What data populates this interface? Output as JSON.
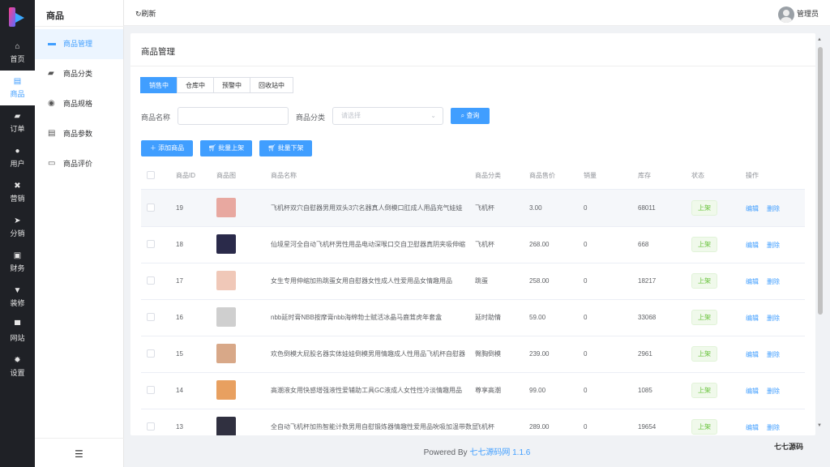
{
  "rail": {
    "items": [
      {
        "label": "首页",
        "icon": "home-icon"
      },
      {
        "label": "商品",
        "icon": "goods-icon"
      },
      {
        "label": "订单",
        "icon": "order-icon"
      },
      {
        "label": "用户",
        "icon": "user-icon"
      },
      {
        "label": "营销",
        "icon": "marketing-icon"
      },
      {
        "label": "分销",
        "icon": "distribution-icon"
      },
      {
        "label": "财务",
        "icon": "finance-icon"
      },
      {
        "label": "装修",
        "icon": "decoration-icon"
      },
      {
        "label": "网站",
        "icon": "website-icon"
      },
      {
        "label": "设置",
        "icon": "settings-icon"
      }
    ],
    "active": 1
  },
  "submenu": {
    "title": "商品",
    "items": [
      {
        "label": "商品管理",
        "icon": "briefcase-icon"
      },
      {
        "label": "商品分类",
        "icon": "category-icon"
      },
      {
        "label": "商品规格",
        "icon": "spec-icon"
      },
      {
        "label": "商品参数",
        "icon": "clipboard-icon"
      },
      {
        "label": "商品评价",
        "icon": "comment-icon"
      }
    ]
  },
  "topbar": {
    "refresh_label": "刷新",
    "user_name": "管理员"
  },
  "page": {
    "title": "商品管理"
  },
  "tabs": [
    "销售中",
    "仓库中",
    "预警中",
    "回收站中"
  ],
  "filters": {
    "name_label": "商品名称",
    "name_value": "",
    "category_label": "商品分类",
    "category_placeholder": "请选择",
    "search_button": "查询"
  },
  "actions": {
    "add": "添加商品",
    "batch_on": "批量上架",
    "batch_off": "批量下架"
  },
  "table": {
    "headers": [
      "商品ID",
      "商品图",
      "商品名称",
      "商品分类",
      "商品售价",
      "销量",
      "库存",
      "状态",
      "操作"
    ],
    "edit_label": "编辑",
    "delete_label": "删除",
    "rows": [
      {
        "id": "19",
        "name": "飞机杯双穴自慰器男用双头3穴名器真人倒模口肛成人用品充气娃娃",
        "category": "飞机杯",
        "price": "3.00",
        "sales": "0",
        "stock": "68011",
        "status": "上架",
        "thumb_color": "#e8a8a0"
      },
      {
        "id": "18",
        "name": "仙境星河全自动飞机杯男性用品电动深喉口交自卫慰器真阴夹吸伸缩",
        "category": "飞机杯",
        "price": "268.00",
        "sales": "0",
        "stock": "668",
        "status": "上架",
        "thumb_color": "#2a2a4a"
      },
      {
        "id": "17",
        "name": "女生专用伸缩加热跳蛋女用自慰器女性成人性爱用品女情趣用品",
        "category": "跳蛋",
        "price": "258.00",
        "sales": "0",
        "stock": "18217",
        "status": "上架",
        "thumb_color": "#f0c8b8"
      },
      {
        "id": "16",
        "name": "nbb延时膏NBB按摩膏nbb海绵勃士赋活冰晶马鹿茸虎年套盒",
        "category": "延时助情",
        "price": "59.00",
        "sales": "0",
        "stock": "33068",
        "status": "上架",
        "thumb_color": "#cfcfcf"
      },
      {
        "id": "15",
        "name": "欢色倒模大屁股名器实体娃娃倒模男用情趣成人性用品飞机杯自慰器",
        "category": "臀胸倒模",
        "price": "239.00",
        "sales": "0",
        "stock": "2961",
        "status": "上架",
        "thumb_color": "#d8a888"
      },
      {
        "id": "14",
        "name": "高潮液女用快感增强液性爱辅助工具GC液成人女性性冷淡情趣用品",
        "category": "尊享高潮",
        "price": "99.00",
        "sales": "0",
        "stock": "1085",
        "status": "上架",
        "thumb_color": "#e8a060"
      },
      {
        "id": "13",
        "name": "全自动飞机杯加热智能计数男用自慰锻炼器情趣性爱用品吮吸加温带数显",
        "category": "飞机杯",
        "price": "289.00",
        "sales": "0",
        "stock": "19654",
        "status": "上架",
        "thumb_color": "#303040"
      }
    ]
  },
  "footer": {
    "prefix": "Powered By",
    "brand": "七七源码网 1.1.6"
  },
  "watermark": "七七源码"
}
